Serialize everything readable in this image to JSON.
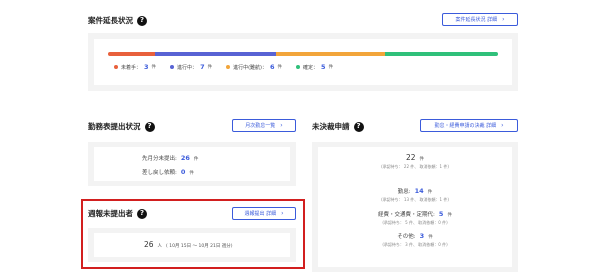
{
  "case_extension": {
    "title": "案件延長状況",
    "detail_button": "案件延長状況 詳細",
    "bar_segments": [
      {
        "key": "not_started",
        "color": "#e8603c",
        "fraction": 0.12
      },
      {
        "key": "in_progress",
        "color": "#5863d4",
        "fraction": 0.31
      },
      {
        "key": "in_progress_difficult",
        "color": "#f2a53a",
        "fraction": 0.28
      },
      {
        "key": "confirmed",
        "color": "#2fc07a",
        "fraction": 0.29
      }
    ],
    "legend": [
      {
        "label": "未着手：",
        "count": "3",
        "unit": "件",
        "color": "#e8603c"
      },
      {
        "label": "進行中：",
        "count": "7",
        "unit": "件",
        "color": "#5863d4"
      },
      {
        "label": "進行中(難航)：",
        "count": "6",
        "unit": "件",
        "color": "#f2a53a"
      },
      {
        "label": "確定：",
        "count": "5",
        "unit": "件",
        "color": "#2fc07a"
      }
    ]
  },
  "attendance": {
    "title": "勤務表提出状況",
    "button": "月次勤怠一覧",
    "rows": [
      {
        "label": "先月分未提出:",
        "count": "26",
        "unit": "件"
      },
      {
        "label": "差し戻し依頼:",
        "count": "0",
        "unit": "件"
      }
    ]
  },
  "weekly": {
    "title": "週報未提出者",
    "button": "週報提出 詳細",
    "count": "26",
    "unit": "人",
    "period": "( 10月 15日 〜 10月 21日 週分)"
  },
  "pending": {
    "title": "未決裁申請",
    "button": "勤怠・経費申請の決裁 詳細",
    "total": {
      "count": "22",
      "unit": "件",
      "sub": "(承認待ち： 22 件、 取消依頼：1 件)"
    },
    "items": [
      {
        "label": "勤怠:",
        "count": "14",
        "unit": "件",
        "sub": "(承認待ち： 13 件、 取消依頼：1 件)"
      },
      {
        "label": "経費・交通費・定期代:",
        "count": "5",
        "unit": "件",
        "sub": "(承認待ち： 5 件、 取消依頼：0 件)"
      },
      {
        "label": "その他:",
        "count": "3",
        "unit": "件",
        "sub": "(承認待ち： 3 件、 取消依頼：0 件)"
      }
    ]
  },
  "colors": {
    "accent": "#3b5bdb",
    "highlight": "#d21f1f",
    "panel": "#f3f3f3"
  }
}
